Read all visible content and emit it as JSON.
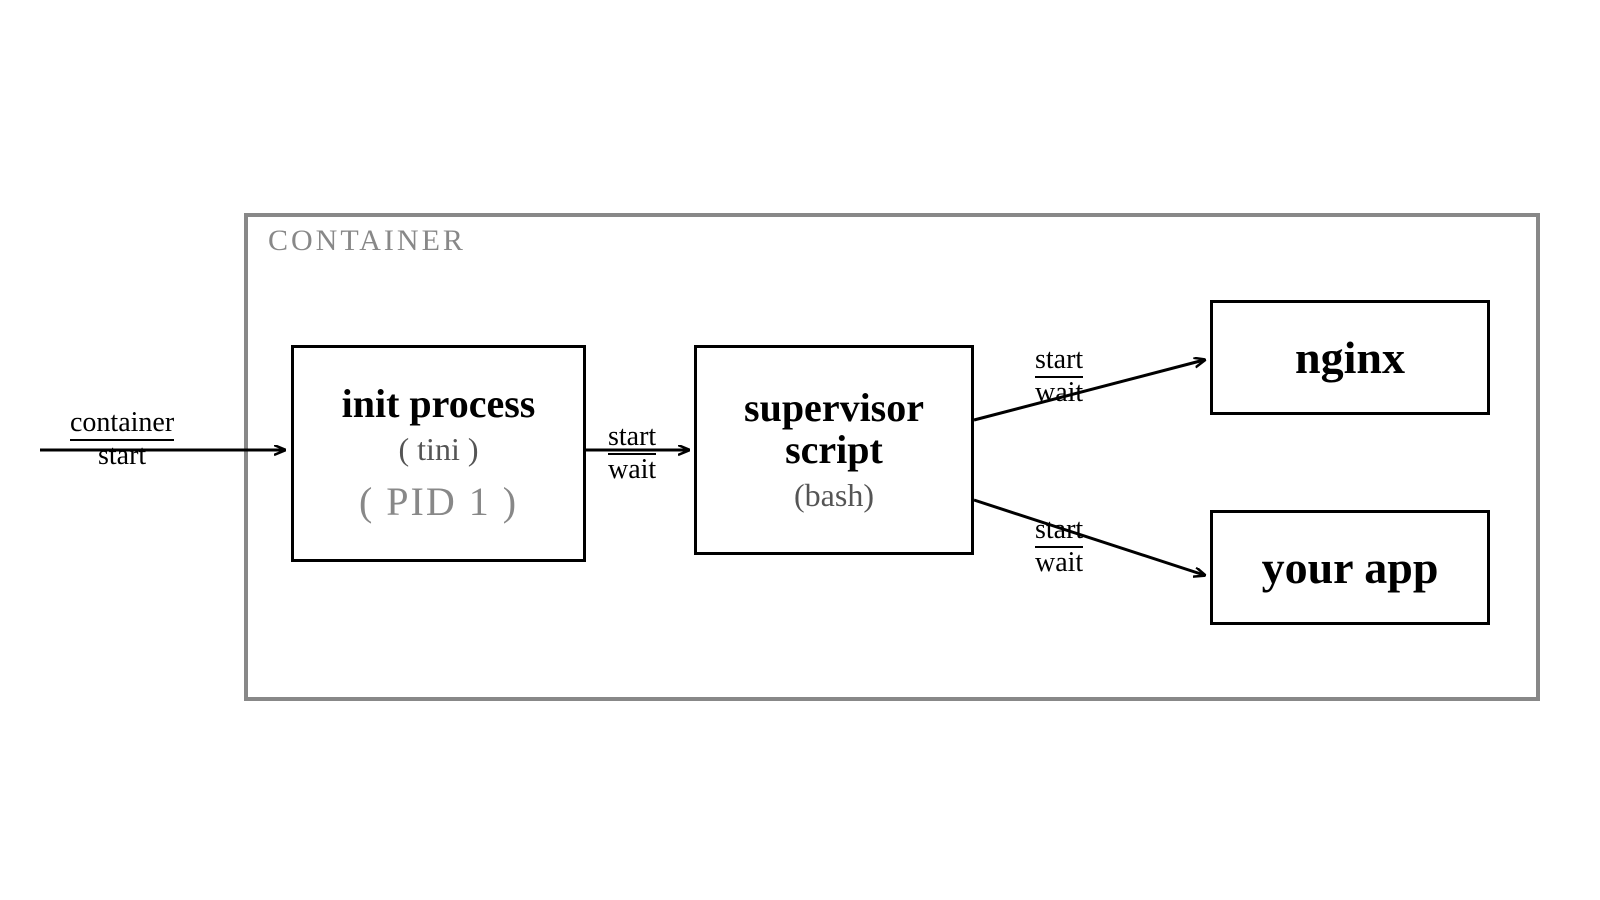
{
  "container": {
    "label": "CONTAINER"
  },
  "boxes": {
    "init": {
      "title": "init process",
      "sub": "( tini )",
      "pid": "( PID 1 )"
    },
    "supervisor": {
      "title1": "supervisor",
      "title2": "script",
      "sub": "(bash)"
    },
    "nginx": {
      "title": "nginx"
    },
    "app": {
      "title": "your app"
    }
  },
  "edges": {
    "in_top": "container",
    "in_bot": "start",
    "sw_top": "start",
    "sw_bot": "wait"
  }
}
